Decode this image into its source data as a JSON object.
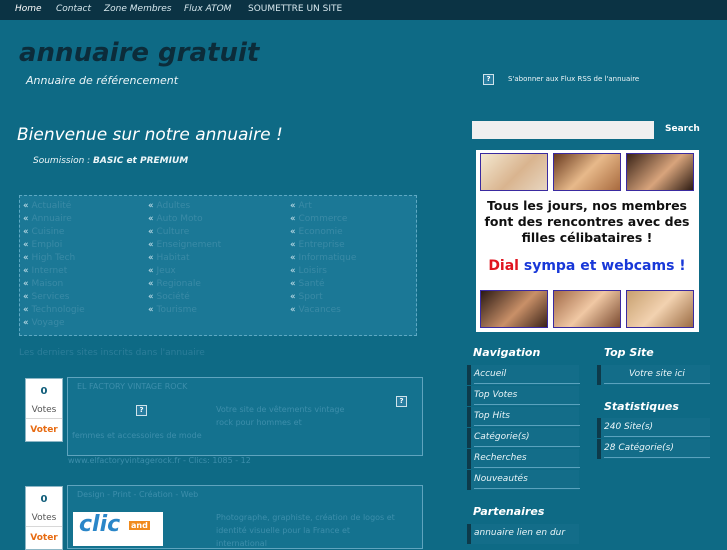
{
  "nav": {
    "items": [
      {
        "label": "Home"
      },
      {
        "label": "Contact"
      },
      {
        "label": "Zone Membres"
      },
      {
        "label": "Flux ATOM"
      },
      {
        "label": "SOUMETTRE UN SITE"
      }
    ]
  },
  "header": {
    "title": "annuaire gratuit",
    "subtitle": "Annuaire de référencement",
    "rss_label": "S'abonner aux Flux RSS de l'annuaire"
  },
  "main": {
    "welcome": "Bienvenue sur notre annuaire !",
    "soumission_label": "Soumission : ",
    "soumission_value": "BASIC et PREMIUM",
    "categories": [
      "Actualité",
      "Adultes",
      "Art",
      "Annuaire",
      "Auto Moto",
      "Commerce",
      "Cuisine",
      "Culture",
      "Economie",
      "Emploi",
      "Enseignement",
      "Entreprise",
      "High Tech",
      "Habitat",
      "Informatique",
      "Internet",
      "Jeux",
      "Loisirs",
      "Maison",
      "Regionale",
      "Santé",
      "Services",
      "Société",
      "Sport",
      "Technologie",
      "Tourisme",
      "Vacances",
      "Voyage"
    ],
    "last_sites_heading": "Les derniers sites inscrits dans l'annuaire",
    "entries": [
      {
        "votes": "0",
        "votes_label": "Votes",
        "vote_button": "Voter",
        "title": "EL FACTORY VINTAGE ROCK",
        "desc1": "Votre site de vêtements vintage",
        "desc2": "rock pour hommes et",
        "desc3": "femmes et accessoires de mode",
        "footer": "www.elfactoryvintagerock.fr - Clics: 1085 - 12"
      },
      {
        "votes": "0",
        "votes_label": "Votes",
        "vote_button": "Voter",
        "title": "Design - Print - Création - Web",
        "desc1": "Photographe, graphiste, création de logos et",
        "desc2": "identité visuelle pour la France et",
        "desc3": "international",
        "logo_text": "clic",
        "logo_sub": "and"
      }
    ]
  },
  "sidebar": {
    "search_placeholder": "",
    "search_button": "Search",
    "ad": {
      "text": "Tous les jours, nos membres font des rencontres avec des filles célibataires !",
      "dial_red": "Dial",
      "dial_blue": " sympa et webcams !"
    },
    "navigation_title": "Navigation",
    "navigation_items": [
      {
        "label": "Accueil"
      },
      {
        "label": "Top Votes"
      },
      {
        "label": "Top Hits"
      },
      {
        "label": "Catégorie(s)"
      },
      {
        "label": "Recherches"
      },
      {
        "label": "Nouveautés"
      }
    ],
    "top_site_title": "Top Site",
    "top_site_item": "Votre site ici",
    "stats_title": "Statistiques",
    "stats_items": [
      {
        "label": "240 Site(s)"
      },
      {
        "label": "28 Catégorie(s)"
      }
    ],
    "partners_title": "Partenaires",
    "partners_item": "annuaire lien en dur"
  },
  "colors": {
    "background": "#0e6a85",
    "topbar": "#0b3344",
    "title": "#0c2c3a",
    "vote_accent": "#e76b12",
    "dial_red": "#e0141f",
    "dial_blue": "#1838d8"
  },
  "icons": [
    "question-mark-icon",
    "rss-icon",
    "bullet-icon"
  ]
}
